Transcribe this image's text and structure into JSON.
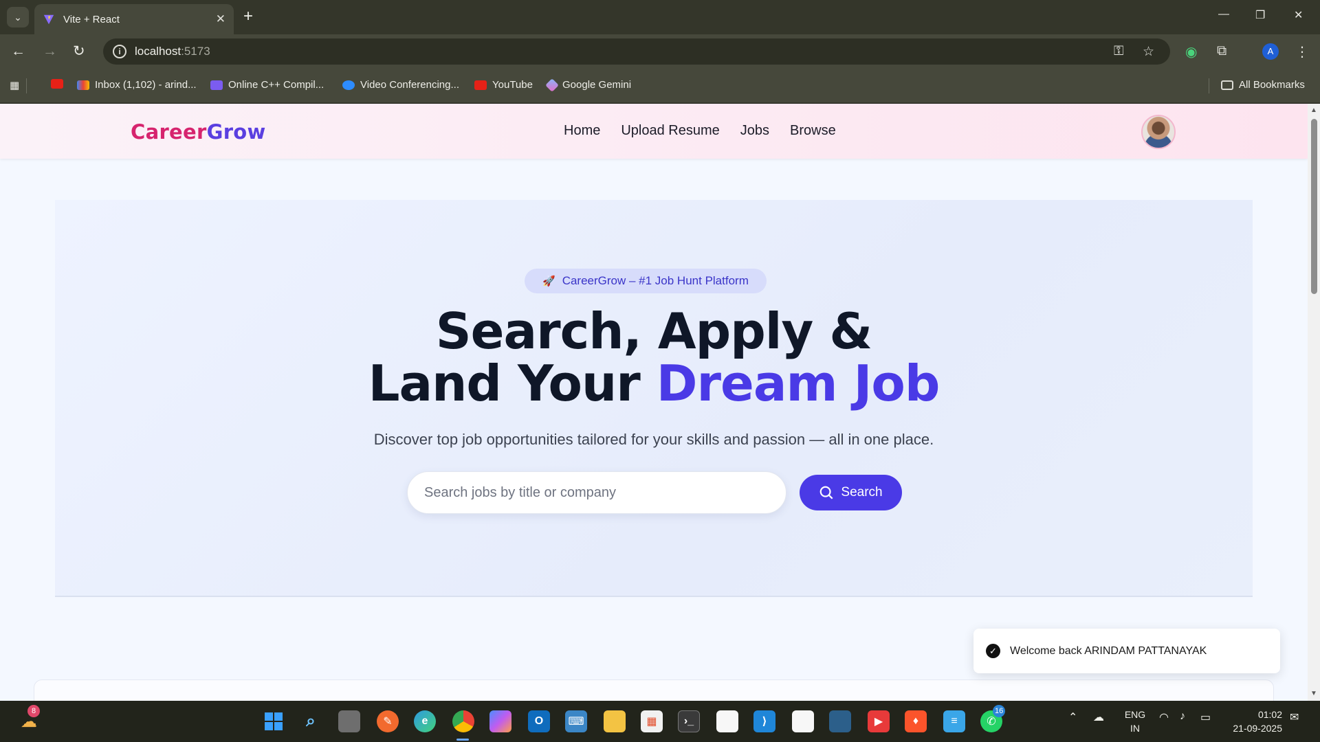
{
  "browser": {
    "tab_title": "Vite + React",
    "url_host": "localhost",
    "url_port": ":5173",
    "bookmarks": [
      {
        "label": "",
        "icon": "youtube-icon",
        "color": "#e62117"
      },
      {
        "label": "Inbox (1,102) - arind...",
        "icon": "gmail-icon",
        "color": "#ea4335"
      },
      {
        "label": "Online C++ Compil...",
        "icon": "bolt-icon",
        "color": "#7b5cf0"
      },
      {
        "label": "Video Conferencing...",
        "icon": "zoom-icon",
        "color": "#2d8cff"
      },
      {
        "label": "YouTube",
        "icon": "youtube-icon",
        "color": "#e62117"
      },
      {
        "label": "Google Gemini",
        "icon": "gemini-icon",
        "color": "#8ab4f8"
      }
    ],
    "all_bookmarks": "All Bookmarks",
    "profile_initial": "A"
  },
  "navbar": {
    "logo_part1": "Career",
    "logo_part2": "Grow",
    "links": [
      "Home",
      "Upload Resume",
      "Jobs",
      "Browse"
    ]
  },
  "hero": {
    "badge": "CareerGrow – #1 Job Hunt Platform",
    "headline_line1": "Search, Apply &",
    "headline_line2_plain": "Land Your ",
    "headline_line2_accent": "Dream Job",
    "subtitle": "Discover top job opportunities tailored for your skills and passion — all in one place.",
    "search_placeholder": "Search jobs by title or company",
    "search_button": "Search"
  },
  "toast": {
    "message": "Welcome back ARINDAM PATTANAYAK"
  },
  "taskbar": {
    "weather_badge": "8",
    "whatsapp_badge": "16",
    "lang_line1": "ENG",
    "lang_line2": "IN",
    "time": "01:02",
    "date": "21-09-2025"
  },
  "colors": {
    "brand_pink": "#d6246e",
    "brand_indigo": "#4a3ae6"
  }
}
